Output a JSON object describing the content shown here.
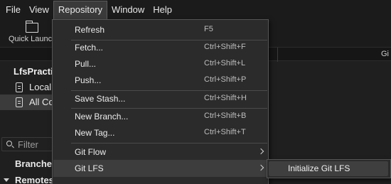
{
  "menubar": {
    "items": [
      "File",
      "View",
      "Repository",
      "Window",
      "Help"
    ]
  },
  "toolbar": {
    "quick_launch_label": "Quick Launch"
  },
  "columns": {
    "right_header": "Gi"
  },
  "sidebar": {
    "repo_name": "LfsPractic",
    "items": [
      {
        "label": "Local",
        "icon": "file-lock-icon"
      },
      {
        "label": "All Co",
        "icon": "document-list-icon"
      }
    ],
    "filter_placeholder": "Filter",
    "branches_label": "Branches",
    "remotes_label": "Remotes"
  },
  "repository_menu": {
    "refresh": {
      "label": "Refresh",
      "shortcut": "F5"
    },
    "fetch": {
      "label": "Fetch...",
      "shortcut": "Ctrl+Shift+F"
    },
    "pull": {
      "label": "Pull...",
      "shortcut": "Ctrl+Shift+L"
    },
    "push": {
      "label": "Push...",
      "shortcut": "Ctrl+Shift+P"
    },
    "save_stash": {
      "label": "Save Stash...",
      "shortcut": "Ctrl+Shift+H"
    },
    "new_branch": {
      "label": "New Branch...",
      "shortcut": "Ctrl+Shift+B"
    },
    "new_tag": {
      "label": "New Tag...",
      "shortcut": "Ctrl+Shift+T"
    },
    "git_flow": {
      "label": "Git Flow"
    },
    "git_lfs": {
      "label": "Git LFS"
    }
  },
  "git_lfs_submenu": {
    "initialize": "Initialize Git LFS"
  },
  "colors": {
    "menu_bg": "#2b2b2b",
    "highlight": "#3d3d3d",
    "app_bg": "#1f1f1f"
  }
}
